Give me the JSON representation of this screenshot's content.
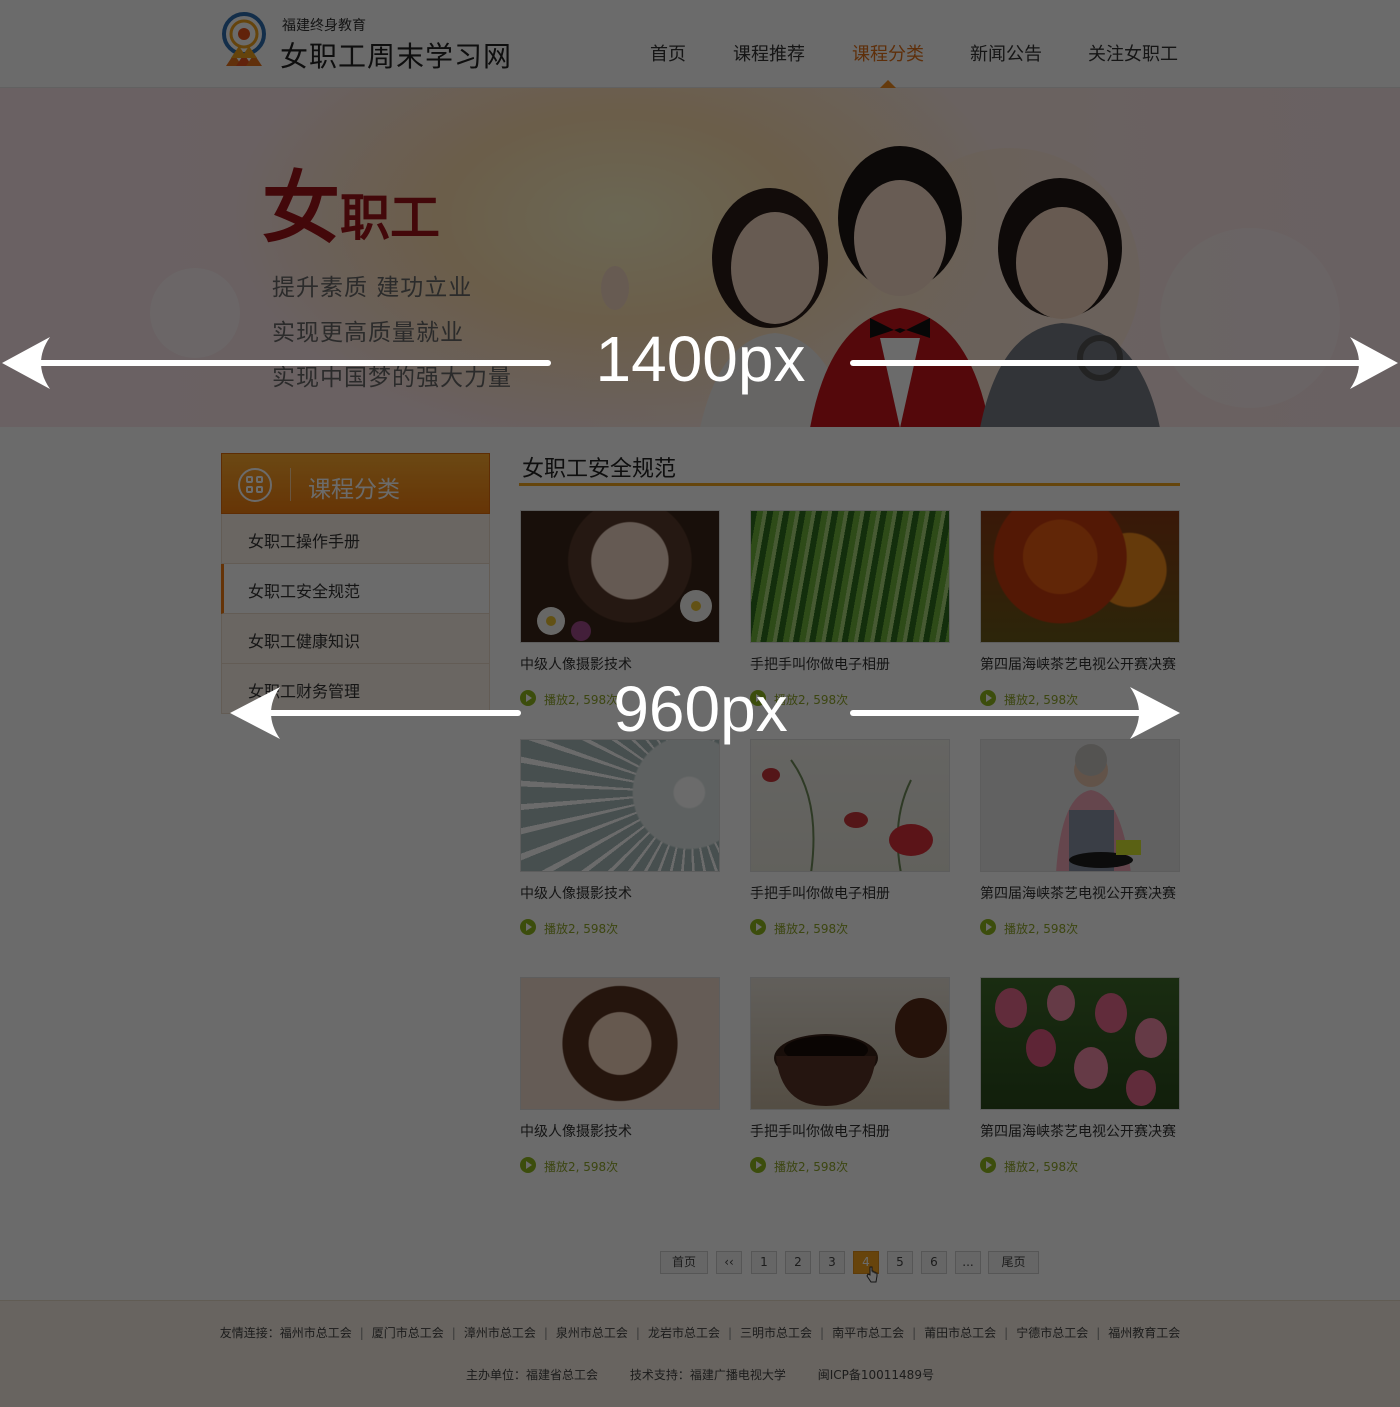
{
  "header": {
    "logo_sub": "福建终身教育",
    "logo_title": "女职工周末学习网",
    "nav": [
      "首页",
      "课程推荐",
      "课程分类",
      "新闻公告",
      "关注女职工"
    ],
    "active_nav": "课程分类"
  },
  "banner": {
    "headline_big": "女",
    "headline_small": "职工",
    "lines": [
      "提升素质 建功立业",
      "实现更高质量就业",
      "实现中国梦的强大力量"
    ]
  },
  "sidebar": {
    "title": "课程分类",
    "items": [
      "女职工操作手册",
      "女职工安全规范",
      "女职工健康知识",
      "女职工财务管理"
    ],
    "active_item": "女职工安全规范"
  },
  "main": {
    "section_title": "女职工安全规范",
    "cards": [
      {
        "title": "中级人像摄影技术",
        "plays": "播放2, 598次",
        "thumb": "portrait-girl-flowers"
      },
      {
        "title": "手把手叫你做电子相册",
        "plays": "播放2, 598次",
        "thumb": "green-willow"
      },
      {
        "title": "第四届海峡茶艺电视公开赛决赛",
        "plays": "播放2, 598次",
        "thumb": "autumn-tree"
      },
      {
        "title": "中级人像摄影技术",
        "plays": "播放2, 598次",
        "thumb": "dandelion"
      },
      {
        "title": "手把手叫你做电子相册",
        "plays": "播放2, 598次",
        "thumb": "red-poppies"
      },
      {
        "title": "第四届海峡茶艺电视公开赛决赛",
        "plays": "播放2, 598次",
        "thumb": "grandma-cooking"
      },
      {
        "title": "中级人像摄影技术",
        "plays": "播放2, 598次",
        "thumb": "portrait-woman"
      },
      {
        "title": "手把手叫你做电子相册",
        "plays": "播放2, 598次",
        "thumb": "coffee-cup"
      },
      {
        "title": "第四届海峡茶艺电视公开赛决赛",
        "plays": "播放2, 598次",
        "thumb": "pink-bell-flowers"
      }
    ]
  },
  "pagination": {
    "first": "首页",
    "prev": "‹‹",
    "pages": [
      "1",
      "2",
      "3",
      "4",
      "5",
      "6"
    ],
    "current": "4",
    "ellipsis": "...",
    "last": "尾页"
  },
  "footer": {
    "links_label": "友情连接：",
    "links": [
      "福州市总工会",
      "厦门市总工会",
      "漳州市总工会",
      "泉州市总工会",
      "龙岩市总工会",
      "三明市总工会",
      "南平市总工会",
      "莆田市总工会",
      "宁德市总工会",
      "福州教育工会"
    ],
    "sponsor": "主办单位：福建省总工会",
    "tech_support": "技术支持：福建广播电视大学",
    "icp": "闽ICP备10011489号"
  },
  "annotations": {
    "page_width_label": "1400px",
    "content_width_label": "960px"
  },
  "colors": {
    "accent": "#f08a1e",
    "nav_active": "#e0701a",
    "play_green": "#8fb81e",
    "overlay": "rgba(0,0,0,0.58)"
  }
}
